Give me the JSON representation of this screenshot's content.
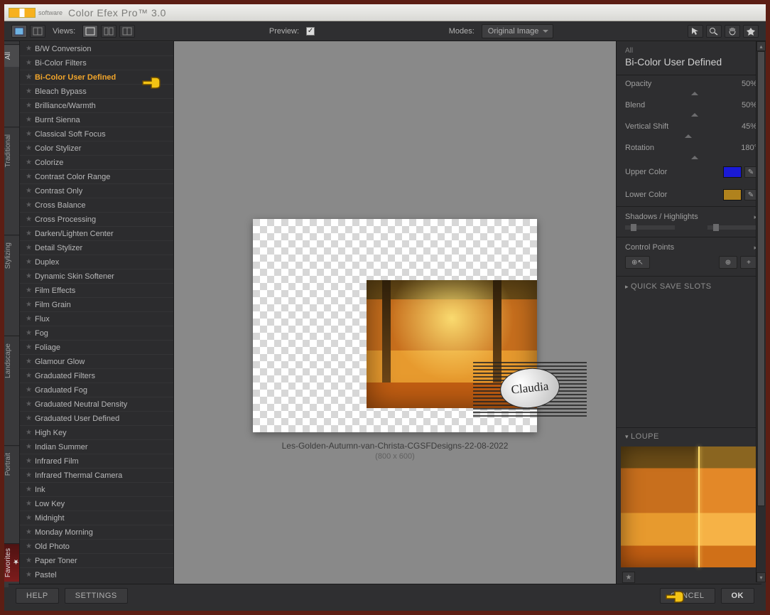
{
  "app": {
    "software_label": "software",
    "title": "Color Efex Pro™ 3.0"
  },
  "topbar": {
    "views_label": "Views:",
    "preview_label": "Preview:",
    "modes_label": "Modes:",
    "mode_selected": "Original Image"
  },
  "side_tabs": [
    "All",
    "Traditional",
    "Stylizing",
    "Landscape",
    "Portrait",
    "Favorites"
  ],
  "filters": [
    "B/W Conversion",
    "Bi-Color Filters",
    "Bi-Color User Defined",
    "Bleach Bypass",
    "Brilliance/Warmth",
    "Burnt Sienna",
    "Classical Soft Focus",
    "Color Stylizer",
    "Colorize",
    "Contrast Color Range",
    "Contrast Only",
    "Cross Balance",
    "Cross Processing",
    "Darken/Lighten Center",
    "Detail Stylizer",
    "Duplex",
    "Dynamic Skin Softener",
    "Film Effects",
    "Film Grain",
    "Flux",
    "Fog",
    "Foliage",
    "Glamour Glow",
    "Graduated Filters",
    "Graduated Fog",
    "Graduated Neutral Density",
    "Graduated User Defined",
    "High Key",
    "Indian Summer",
    "Infrared Film",
    "Infrared Thermal Camera",
    "Ink",
    "Low Key",
    "Midnight",
    "Monday Morning",
    "Old Photo",
    "Paper Toner",
    "Pastel"
  ],
  "selected_filter": "Bi-Color User Defined",
  "preview": {
    "filename": "Les-Golden-Autumn-van-Christa-CGSFDesigns-22-08-2022",
    "dims": "(800 x 600)",
    "watermark": "Claudia"
  },
  "panel": {
    "category": "All",
    "title": "Bi-Color User Defined",
    "sliders": [
      {
        "label": "Opacity",
        "value": "50%",
        "pos": 50
      },
      {
        "label": "Blend",
        "value": "50%",
        "pos": 50
      },
      {
        "label": "Vertical Shift",
        "value": "45%",
        "pos": 45
      },
      {
        "label": "Rotation",
        "value": "180°",
        "pos": 50
      }
    ],
    "upper_color_label": "Upper Color",
    "upper_color": "#1a1ad6",
    "lower_color_label": "Lower Color",
    "lower_color": "#b0821d",
    "shadows_label": "Shadows / Highlights",
    "control_points_label": "Control Points",
    "quick_save_label": "QUICK SAVE SLOTS",
    "loupe_label": "LOUPE"
  },
  "footer": {
    "help": "HELP",
    "settings": "SETTINGS",
    "cancel": "CANCEL",
    "ok": "OK"
  }
}
